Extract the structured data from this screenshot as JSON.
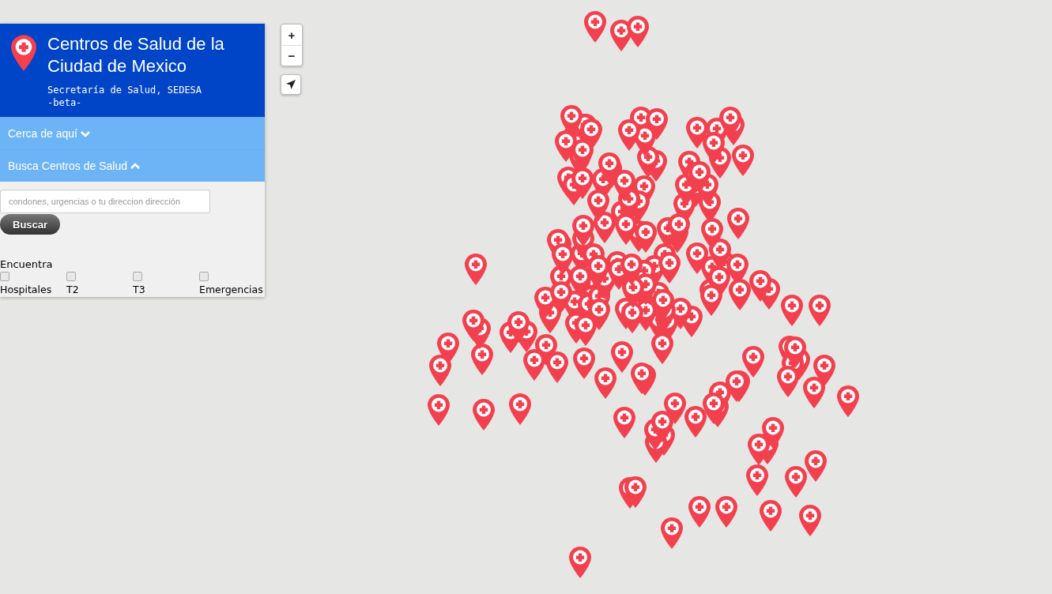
{
  "header": {
    "title": "Centros de Salud de la Ciudad de Mexico",
    "subtitle": "Secretaría de Salud, SEDESA",
    "tag": "-beta-"
  },
  "sections": [
    {
      "label": "Cerca de aquí",
      "expanded": false
    },
    {
      "label": "Busca Centros de Salud",
      "expanded": true
    }
  ],
  "search": {
    "placeholder": "condones, urgencias o tu direccion dirección",
    "button": "Buscar"
  },
  "filters": {
    "label": "Encuentra",
    "options": [
      {
        "label": "Hospitales",
        "checked": false
      },
      {
        "label": "T2",
        "checked": false
      },
      {
        "label": "T3",
        "checked": false
      },
      {
        "label": "Emergencias",
        "checked": false
      }
    ]
  },
  "map_controls": {
    "zoom_in": "+",
    "zoom_out": "−"
  }
}
